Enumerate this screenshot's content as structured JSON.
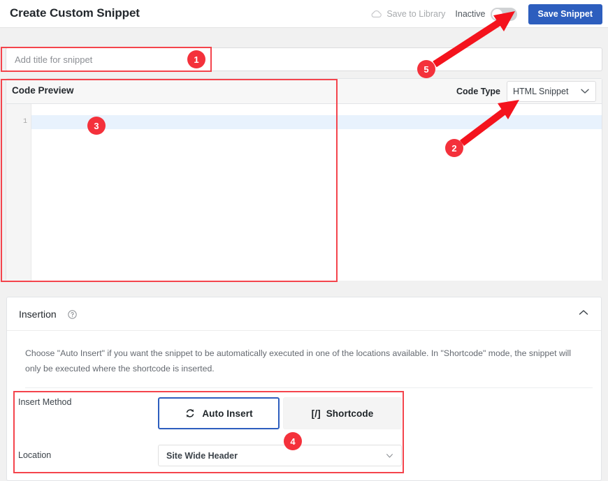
{
  "header": {
    "page_title": "Create Custom Snippet",
    "cloud_icon": "cloud-icon",
    "save_to_library_label": "Save to Library",
    "toggle_state_label": "Inactive",
    "save_snippet_label": "Save Snippet",
    "accent_blue": "#2d5ebe"
  },
  "title_field": {
    "value": "",
    "placeholder": "Add title for snippet"
  },
  "code_panel": {
    "heading": "Code Preview",
    "code_type_label": "Code Type",
    "code_type_value": "HTML Snippet",
    "chevron_icon": "chevron-down-icon",
    "line_number": "1",
    "code_content": ""
  },
  "insertion": {
    "title": "Insertion",
    "help_icon": "question-mark-circle-icon",
    "collapse_icon": "chevron-up-icon",
    "description": "Choose \"Auto Insert\" if you want the snippet to be automatically executed in one of the locations available. In \"Shortcode\" mode, the snippet will only be executed where the shortcode is inserted.",
    "insert_method_label": "Insert Method",
    "auto_insert_label": "Auto Insert",
    "auto_insert_icon": "refresh-icon",
    "shortcode_label": "Shortcode",
    "shortcode_icon": "[/]",
    "location_label": "Location",
    "location_value": "Site Wide Header",
    "location_caret_icon": "caret-down-icon"
  },
  "annotations": {
    "color": "#f4313b",
    "badges": [
      {
        "id": "1",
        "label": "1"
      },
      {
        "id": "2",
        "label": "2"
      },
      {
        "id": "3",
        "label": "3"
      },
      {
        "id": "4",
        "label": "4"
      },
      {
        "id": "5",
        "label": "5"
      }
    ]
  }
}
